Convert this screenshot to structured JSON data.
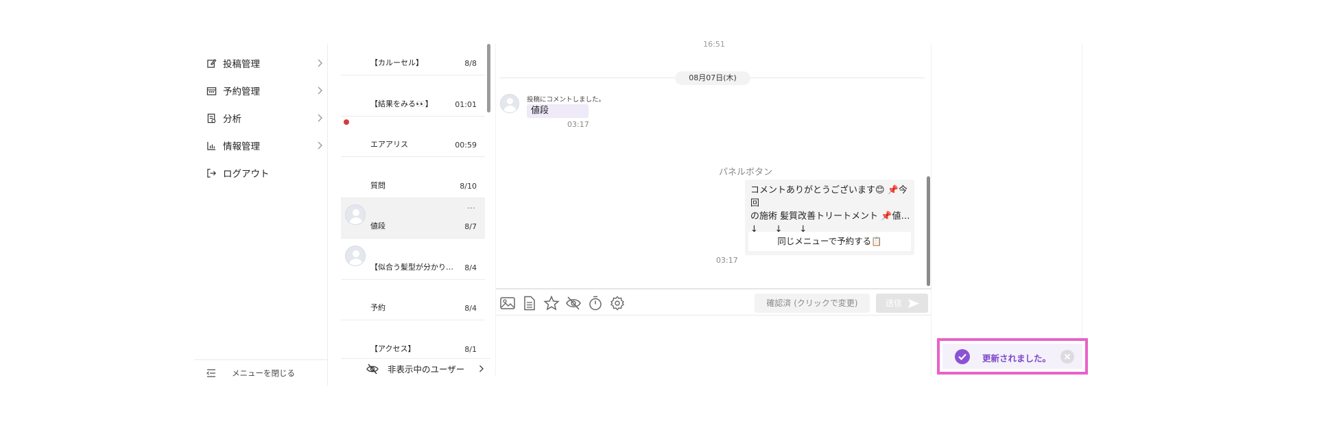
{
  "sidebar": {
    "items": [
      {
        "label": "投稿管理",
        "icon": "edit-icon"
      },
      {
        "label": "予約管理",
        "icon": "calendar-icon"
      },
      {
        "label": "分析",
        "icon": "report-icon"
      },
      {
        "label": "情報管理",
        "icon": "chart-icon"
      },
      {
        "label": "ログアウト",
        "icon": "logout-icon"
      }
    ],
    "footer_label": "メニューを閉じる"
  },
  "conversations": [
    {
      "name": "【カルーセル】",
      "date": "8/8"
    },
    {
      "name": "【結果をみる👀】",
      "date": "01:01"
    },
    {
      "name": "エアアリス",
      "date": "00:59"
    },
    {
      "name": "質問",
      "date": "8/10"
    },
    {
      "name": "値段",
      "date": "8/7",
      "menu": "…"
    },
    {
      "name": "【似合う髪型が分かり…",
      "date": "8/4"
    },
    {
      "name": "予約",
      "date": "8/4"
    },
    {
      "name": "【アクセス】",
      "date": "8/1"
    }
  ],
  "hidden_users_label": "非表示中のユーザー",
  "chat": {
    "time_top": "16:51",
    "date_separator": "08月07日(木)",
    "incoming": {
      "caption": "投稿にコメントしました。",
      "text": "値段",
      "time": "03:17"
    },
    "outgoing": {
      "label": "パネルボタン",
      "text": "コメントありがとうございます😊 📌今回\nの施術 髪質改善トリートメント 📌値…\n↓      ↓      ↓",
      "button": "同じメニューで予約する📋",
      "time": "03:17"
    },
    "toolbar": {
      "icons": [
        "image-icon",
        "document-icon",
        "star-icon",
        "eye-off-icon",
        "timer-icon",
        "settings-icon"
      ],
      "confirm_label": "確認済 (クリックで変更)",
      "send_label": "送信"
    }
  },
  "toast": {
    "message": "更新されました。",
    "accent": "#8b52d6",
    "border": "#e861c8"
  }
}
